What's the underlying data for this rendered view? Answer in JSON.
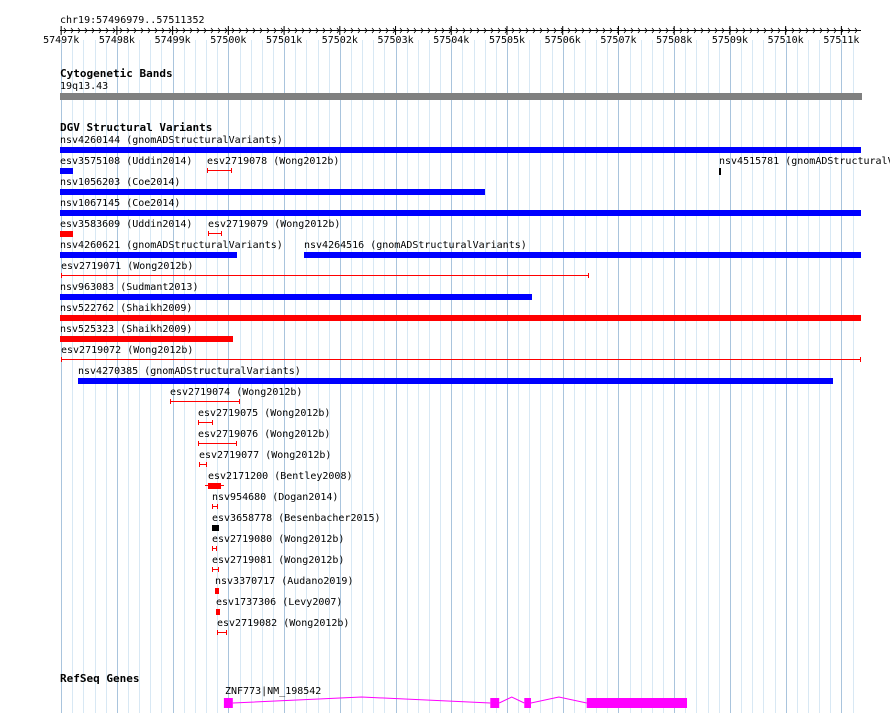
{
  "ruler": {
    "location": "chr19:57496979..57511352",
    "ticks": [
      "57497k",
      "57498k",
      "57499k",
      "57500k",
      "57501k",
      "57502k",
      "57503k",
      "57504k",
      "57505k",
      "57506k",
      "57507k",
      "57508k",
      "57509k",
      "57510k",
      "57511k"
    ],
    "start": 57496979,
    "end": 57511352
  },
  "cytoband": {
    "title": "Cytogenetic Bands",
    "band": "19q13.43",
    "color": "#808080"
  },
  "dgv": {
    "title": "DGV Structural Variants",
    "colors": {
      "gain": "#0000ff",
      "loss": "#ff0000",
      "indel": "#000000"
    },
    "features": [
      {
        "label": "nsv4260144 (gnomADStructuralVariants)",
        "start": 57496979,
        "end": 57511352,
        "color": "#0000ff",
        "style": "bar"
      },
      {
        "label": "esv3575108 (Uddin2014)",
        "start": 57496979,
        "end": 57497210,
        "color": "#0000ff",
        "style": "bar"
      },
      {
        "label": "esv2719078 (Wong2012b)",
        "start": 57499620,
        "end": 57500070,
        "color": "#ff0000",
        "style": "bracket"
      },
      {
        "label": "nsv4515781 (gnomADStructuralV",
        "start": 57508810,
        "end": 57508840,
        "color": "#000000",
        "style": "bar"
      },
      {
        "label": "nsv1056203 (Coe2014)",
        "start": 57496979,
        "end": 57504600,
        "color": "#0000ff",
        "style": "bar"
      },
      {
        "label": "nsv1067145 (Coe2014)",
        "start": 57496979,
        "end": 57511352,
        "color": "#0000ff",
        "style": "bar"
      },
      {
        "label": "esv3583609 (Uddin2014)",
        "start": 57496979,
        "end": 57497210,
        "color": "#ff0000",
        "style": "bar"
      },
      {
        "label": "esv2719079 (Wong2012b)",
        "start": 57499630,
        "end": 57499880,
        "color": "#ff0000",
        "style": "bracket"
      },
      {
        "label": "nsv4260621 (gnomADStructuralVariants)",
        "start": 57496979,
        "end": 57500150,
        "color": "#0000ff",
        "style": "bar"
      },
      {
        "label": "nsv4264516 (gnomADStructuralVariants)",
        "start": 57501350,
        "end": 57511352,
        "color": "#0000ff",
        "style": "bar"
      },
      {
        "label": "esv2719071 (Wong2012b)",
        "start": 57497000,
        "end": 57506480,
        "color": "#ff0000",
        "style": "bracket"
      },
      {
        "label": "nsv963083 (Sudmant2013)",
        "start": 57496979,
        "end": 57505450,
        "color": "#0000ff",
        "style": "bar"
      },
      {
        "label": "nsv522762 (Shaikh2009)",
        "start": 57496979,
        "end": 57511352,
        "color": "#ff0000",
        "style": "bar"
      },
      {
        "label": "nsv525323 (Shaikh2009)",
        "start": 57496979,
        "end": 57500080,
        "color": "#ff0000",
        "style": "bar"
      },
      {
        "label": "esv2719072 (Wong2012b)",
        "start": 57497000,
        "end": 57511352,
        "color": "#ff0000",
        "style": "bracket"
      },
      {
        "label": "nsv4270385 (gnomADStructuralVariants)",
        "start": 57497300,
        "end": 57510850,
        "color": "#0000ff",
        "style": "bar"
      },
      {
        "label": "esv2719074 (Wong2012b)",
        "start": 57498950,
        "end": 57500200,
        "color": "#ff0000",
        "style": "bracket"
      },
      {
        "label": "esv2719075 (Wong2012b)",
        "start": 57499450,
        "end": 57499720,
        "color": "#ff0000",
        "style": "bracket"
      },
      {
        "label": "esv2719076 (Wong2012b)",
        "start": 57499450,
        "end": 57500150,
        "color": "#ff0000",
        "style": "bracket"
      },
      {
        "label": "esv2719077 (Wong2012b)",
        "start": 57499470,
        "end": 57499620,
        "color": "#ff0000",
        "style": "bracket"
      },
      {
        "label": "esv2171200 (Bentley2008)",
        "start": 57499630,
        "end": 57499860,
        "color": "#ff0000",
        "style": "barwide"
      },
      {
        "label": "nsv954680 (Dogan2014)",
        "start": 57499710,
        "end": 57499820,
        "color": "#ff0000",
        "style": "bracket"
      },
      {
        "label": "esv3658778 (Besenbacher2015)",
        "start": 57499710,
        "end": 57499830,
        "color": "#000000",
        "style": "bar"
      },
      {
        "label": "esv2719080 (Wong2012b)",
        "start": 57499710,
        "end": 57499790,
        "color": "#ff0000",
        "style": "bracket"
      },
      {
        "label": "esv2719081 (Wong2012b)",
        "start": 57499710,
        "end": 57499830,
        "color": "#ff0000",
        "style": "bracket"
      },
      {
        "label": "nsv3370717 (Audano2019)",
        "start": 57499760,
        "end": 57499830,
        "color": "#ff0000",
        "style": "bar"
      },
      {
        "label": "esv1737306 (Levy2007)",
        "start": 57499780,
        "end": 57499850,
        "color": "#ff0000",
        "style": "bar"
      },
      {
        "label": "esv2719082 (Wong2012b)",
        "start": 57499790,
        "end": 57499980,
        "color": "#ff0000",
        "style": "bracket"
      }
    ]
  },
  "refseq": {
    "title": "RefSeq Genes",
    "gene": {
      "label": "ZNF773|NM_198542",
      "color": "#ff00ff",
      "start": 57499920,
      "end": 57508230,
      "exons": [
        {
          "start": 57499920,
          "end": 57500080
        },
        {
          "start": 57504700,
          "end": 57504860
        },
        {
          "start": 57505310,
          "end": 57505430
        },
        {
          "start": 57506430,
          "end": 57508230
        }
      ]
    }
  }
}
